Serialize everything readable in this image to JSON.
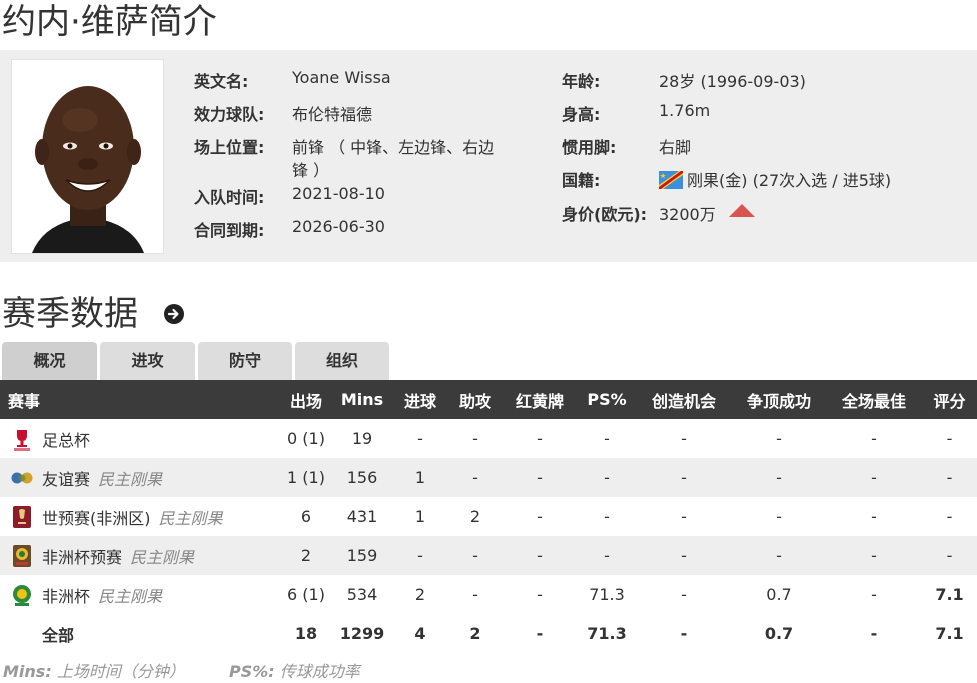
{
  "page_title": "约内·维萨简介",
  "profile": {
    "left": [
      {
        "label": "英文名:",
        "value": "Yoane Wissa"
      },
      {
        "label": "效力球队:",
        "value": "布伦特福德"
      },
      {
        "label": "场上位置:",
        "value": "前锋 （ 中锋、左边锋、右边",
        "value2": "锋 ）"
      },
      {
        "label": "入队时间:",
        "value": "2021-08-10"
      },
      {
        "label": "合同到期:",
        "value": "2026-06-30"
      }
    ],
    "right": [
      {
        "label": "年龄:",
        "value": "28岁  (1996-09-03)"
      },
      {
        "label": "身高:",
        "value": "1.76m"
      },
      {
        "label": "惯用脚:",
        "value": "右脚"
      },
      {
        "label": "国籍:",
        "value": "刚果(金) (27次入选 / 进5球)"
      },
      {
        "label": "身价(欧元):",
        "value": "3200万"
      }
    ],
    "market_trend": "up",
    "trend_color": "#d9534f"
  },
  "section_title": "赛季数据",
  "tabs": [
    "概况",
    "进攻",
    "防守",
    "组织"
  ],
  "active_tab": "概况",
  "table": {
    "headers": [
      "赛事",
      "出场",
      "Mins",
      "进球",
      "助攻",
      "红黄牌",
      "PS%",
      "创造机会",
      "争顶成功",
      "全场最佳",
      "评分"
    ],
    "rows": [
      {
        "logo": "fa-cup-icon",
        "name": "足总杯",
        "team": "",
        "apps": "0 (1)",
        "mins": "19",
        "goals": "-",
        "assists": "-",
        "cards": "-",
        "ps": "-",
        "chances": "-",
        "aerial": "-",
        "motm": "-",
        "rating": "-"
      },
      {
        "logo": "friendly-icon",
        "name": "友谊赛",
        "team": "民主刚果",
        "apps": "1 (1)",
        "mins": "156",
        "goals": "1",
        "assists": "-",
        "cards": "-",
        "ps": "-",
        "chances": "-",
        "aerial": "-",
        "motm": "-",
        "rating": "-"
      },
      {
        "logo": "wc-qualifier-icon",
        "name": "世预赛(非洲区)",
        "team": "民主刚果",
        "apps": "6",
        "mins": "431",
        "goals": "1",
        "assists": "2",
        "cards": "-",
        "ps": "-",
        "chances": "-",
        "aerial": "-",
        "motm": "-",
        "rating": "-"
      },
      {
        "logo": "afcon-qualifier-icon",
        "name": "非洲杯预赛",
        "team": "民主刚果",
        "apps": "2",
        "mins": "159",
        "goals": "-",
        "assists": "-",
        "cards": "-",
        "ps": "-",
        "chances": "-",
        "aerial": "-",
        "motm": "-",
        "rating": "-"
      },
      {
        "logo": "afcon-icon",
        "name": "非洲杯",
        "team": "民主刚果",
        "apps": "6 (1)",
        "mins": "534",
        "goals": "2",
        "assists": "-",
        "cards": "-",
        "ps": "71.3",
        "chances": "-",
        "aerial": "0.7",
        "motm": "-",
        "rating": "7.1"
      }
    ],
    "total": {
      "name": "全部",
      "apps": "18",
      "mins": "1299",
      "goals": "4",
      "assists": "2",
      "cards": "-",
      "ps": "71.3",
      "chances": "-",
      "aerial": "0.7",
      "motm": "-",
      "rating": "7.1"
    }
  },
  "footnote": {
    "mins_key": "Mins:",
    "mins_text": "上场时间（分钟）",
    "ps_key": "PS%:",
    "ps_text": "传球成功率"
  },
  "colors": {
    "header_bg": "#3b3b3b",
    "rating": "#e07a20",
    "card_bg": "#eeeeee"
  }
}
